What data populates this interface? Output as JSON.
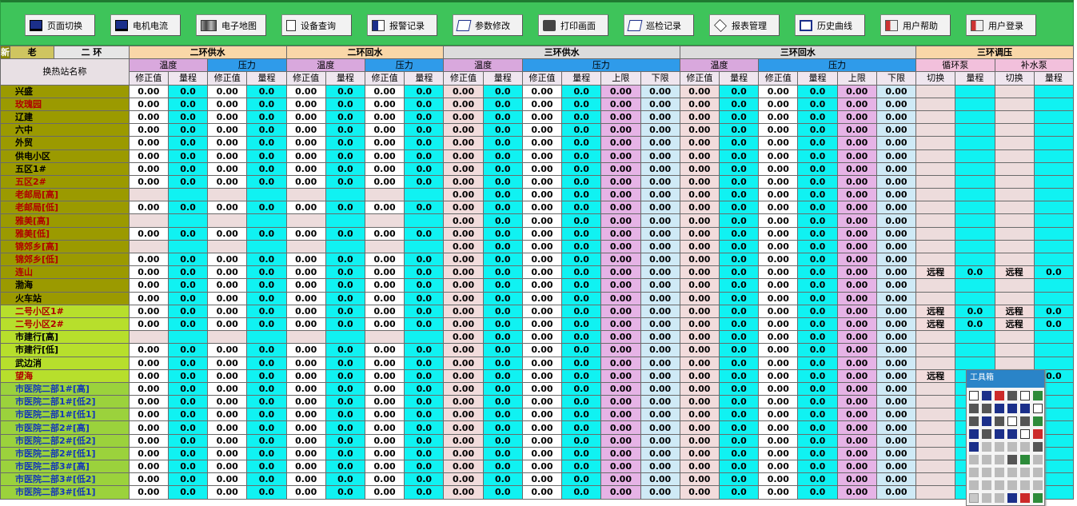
{
  "toolbar": {
    "buttons": [
      {
        "label": "页面切换",
        "icon": "monitor-icon"
      },
      {
        "label": "电机电流",
        "icon": "monitor-icon"
      },
      {
        "label": "电子地图",
        "icon": "map-icon"
      },
      {
        "label": "设备查询",
        "icon": "document-icon"
      },
      {
        "label": "报警记录",
        "icon": "alarm-icon"
      },
      {
        "label": "参数修改",
        "icon": "edit-icon"
      },
      {
        "label": "打印画面",
        "icon": "printer-icon"
      },
      {
        "label": "巡检记录",
        "icon": "edit-icon"
      },
      {
        "label": "报表管理",
        "icon": "report-icon"
      },
      {
        "label": "历史曲线",
        "icon": "curve-icon"
      },
      {
        "label": "用户帮助",
        "icon": "user-icon"
      },
      {
        "label": "用户登录",
        "icon": "user-icon"
      }
    ]
  },
  "table": {
    "tabs": {
      "new": "新",
      "old": "老",
      "ring": "二 环"
    },
    "name_header": "换热站名称",
    "groups": {
      "g1": "二环供水",
      "g2": "二环回水",
      "g3": "三环供水",
      "g4": "三环回水",
      "g5": "三环调压"
    },
    "subgroups": {
      "temp": "温度",
      "pres": "压力",
      "circ": "循环泵",
      "makeup": "补水泵"
    },
    "cols": {
      "corr": "修正值",
      "range": "量程",
      "upper": "上限",
      "lower": "下限",
      "switch": "切换"
    },
    "values": {
      "z2": "0.00",
      "z1": "0.0",
      "sw": "远程"
    },
    "rows": [
      {
        "name": "兴盛",
        "color": "black",
        "bg": "olive",
        "half": false,
        "pump": false
      },
      {
        "name": "玫瑰园",
        "color": "red",
        "bg": "olive",
        "half": false,
        "pump": false
      },
      {
        "name": "辽建",
        "color": "black",
        "bg": "olive",
        "half": false,
        "pump": false
      },
      {
        "name": "六中",
        "color": "black",
        "bg": "olive",
        "half": false,
        "pump": false
      },
      {
        "name": "外贸",
        "color": "black",
        "bg": "olive",
        "half": false,
        "pump": false
      },
      {
        "name": "供电小区",
        "color": "black",
        "bg": "olive",
        "half": false,
        "pump": false
      },
      {
        "name": "五区1#",
        "color": "black",
        "bg": "olive",
        "half": false,
        "pump": false
      },
      {
        "name": "五区2#",
        "color": "red",
        "bg": "olive",
        "half": false,
        "pump": false
      },
      {
        "name": "老邮局[高]",
        "color": "red",
        "bg": "olive",
        "half": true,
        "pump": false
      },
      {
        "name": "老邮局[低]",
        "color": "red",
        "bg": "olive",
        "half": false,
        "pump": false
      },
      {
        "name": "雅美[高]",
        "color": "red",
        "bg": "olive",
        "half": true,
        "pump": false
      },
      {
        "name": "雅美[低]",
        "color": "red",
        "bg": "olive",
        "half": false,
        "pump": false
      },
      {
        "name": "锦郊乡[高]",
        "color": "red",
        "bg": "olive",
        "half": true,
        "pump": false
      },
      {
        "name": "锦郊乡[低]",
        "color": "red",
        "bg": "olive",
        "half": false,
        "pump": false
      },
      {
        "name": "连山",
        "color": "red",
        "bg": "olive",
        "half": false,
        "pump": true
      },
      {
        "name": "渤海",
        "color": "black",
        "bg": "olive",
        "half": false,
        "pump": false
      },
      {
        "name": "火车站",
        "color": "black",
        "bg": "olive",
        "half": false,
        "pump": false
      },
      {
        "name": "二号小区1#",
        "color": "red",
        "bg": "yg",
        "half": false,
        "pump": true
      },
      {
        "name": "二号小区2#",
        "color": "red",
        "bg": "yg",
        "half": false,
        "pump": true
      },
      {
        "name": "市建行[高]",
        "color": "black",
        "bg": "yg",
        "half": true,
        "pump": false
      },
      {
        "name": "市建行[低]",
        "color": "black",
        "bg": "yg",
        "half": false,
        "pump": false
      },
      {
        "name": "武边消",
        "color": "black",
        "bg": "yg",
        "half": false,
        "pump": false
      },
      {
        "name": "望海",
        "color": "red",
        "bg": "yg",
        "half": false,
        "pump": true
      },
      {
        "name": "市医院二部1#[高]",
        "color": "blue",
        "bg": "lg",
        "half": false,
        "pump": false
      },
      {
        "name": "市医院二部1#[低2]",
        "color": "blue",
        "bg": "lg",
        "half": false,
        "pump": false
      },
      {
        "name": "市医院二部1#[低1]",
        "color": "blue",
        "bg": "lg",
        "half": false,
        "pump": false
      },
      {
        "name": "市医院二部2#[高]",
        "color": "blue",
        "bg": "lg",
        "half": false,
        "pump": false
      },
      {
        "name": "市医院二部2#[低2]",
        "color": "blue",
        "bg": "lg",
        "half": false,
        "pump": false
      },
      {
        "name": "市医院二部2#[低1]",
        "color": "blue",
        "bg": "lg",
        "half": false,
        "pump": false
      },
      {
        "name": "市医院二部3#[高]",
        "color": "blue",
        "bg": "lg",
        "half": false,
        "pump": false
      },
      {
        "name": "市医院二部3#[低2]",
        "color": "blue",
        "bg": "lg",
        "half": false,
        "pump": false
      },
      {
        "name": "市医院二部3#[低1]",
        "color": "blue",
        "bg": "lg",
        "half": false,
        "pump": false
      }
    ]
  },
  "toolbox": {
    "title": "工具箱"
  }
}
